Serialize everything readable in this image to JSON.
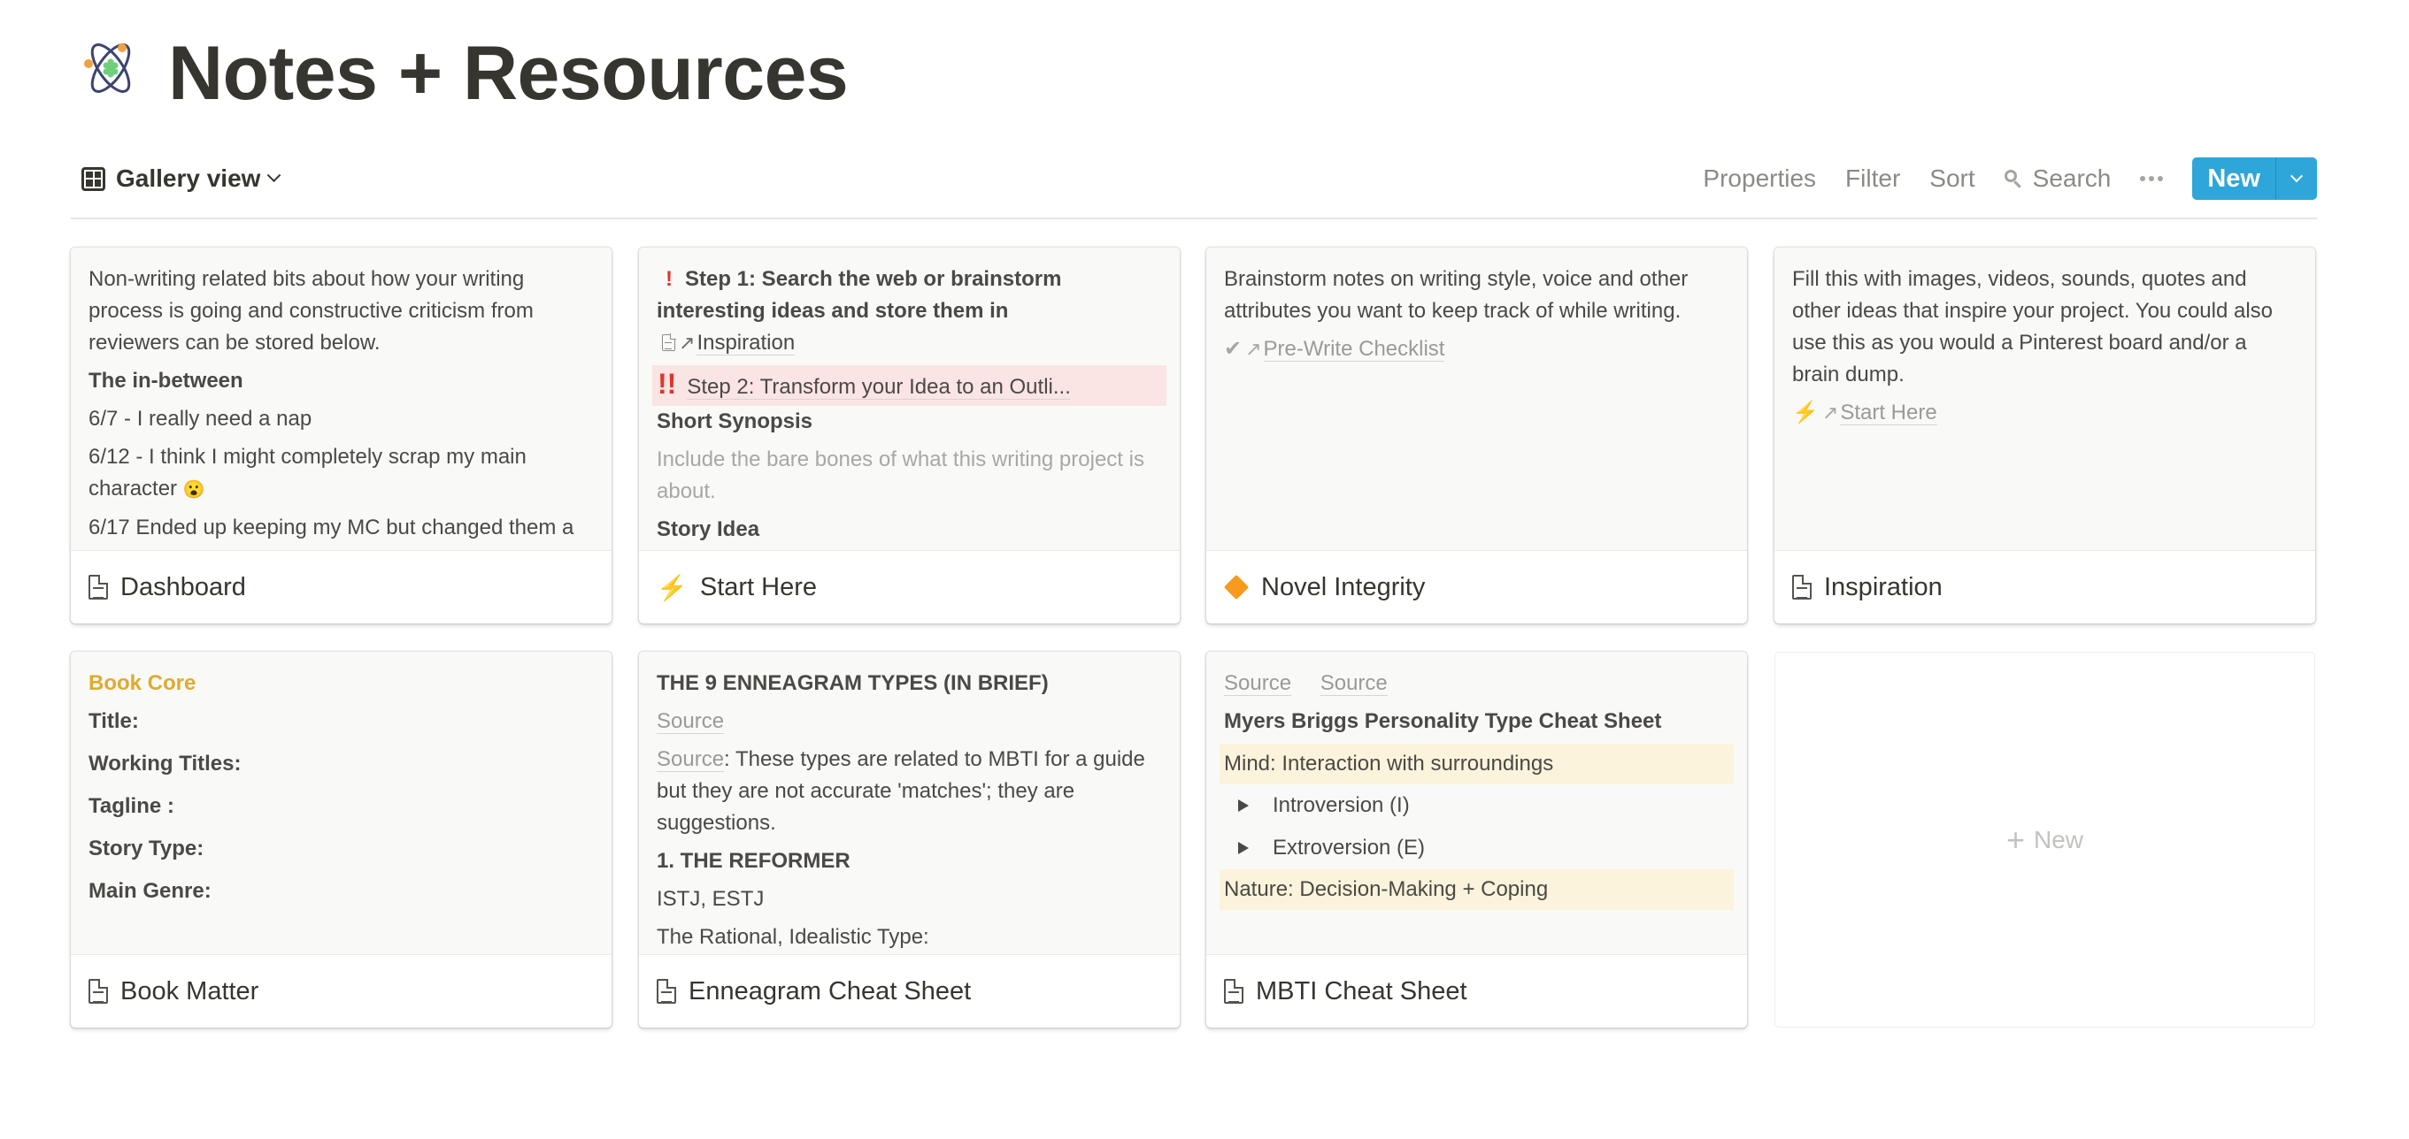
{
  "page": {
    "title": "Notes + Resources",
    "icon": "atom-icon"
  },
  "toolbar": {
    "view_label": "Gallery view",
    "view_icon": "gallery-grid-icon",
    "properties": "Properties",
    "filter": "Filter",
    "sort": "Sort",
    "search": "Search",
    "more": "more-options-icon",
    "new": "New"
  },
  "colors": {
    "accent_blue": "#2ea6d9",
    "title_text": "#37352f",
    "muted_text": "#8b8a86",
    "highlight_red": "#fbe4e4",
    "highlight_yellow": "#fbf3db",
    "gold_heading": "#dfab2f"
  },
  "cards": [
    {
      "title": "Dashboard",
      "icon": "page-icon",
      "preview": {
        "intro": "Non-writing related bits about how your writing process is going and constructive criticism from reviewers can be stored below.",
        "heading": "The in-between",
        "entries": [
          "6/7 - I really need a nap",
          "6/12 - I think I might completely scrap my main character",
          "6/17 Ended up keeping my MC but changed them a"
        ],
        "emoji": "😮"
      }
    },
    {
      "title": "Start Here",
      "icon": "lightning-icon",
      "preview": {
        "step1": "Step 1: Search the web or brainstorm interesting ideas and store them in",
        "step1_link": "Inspiration",
        "step2": "Step 2: Transform your Idea to an Outli...",
        "heading": "Short Synopsis",
        "placeholder": "Include the bare bones of what this writing project is about.",
        "clipped": "Story Idea"
      }
    },
    {
      "title": "Novel Integrity",
      "icon": "orange-diamond-icon",
      "preview": {
        "intro": "Brainstorm notes on writing style, voice and other attributes you want to keep track of while writing.",
        "link": "Pre-Write Checklist"
      }
    },
    {
      "title": "Inspiration",
      "icon": "page-icon",
      "preview": {
        "intro": "Fill this with images, videos, sounds, quotes and other ideas that inspire your project. You could also use this as you would a Pinterest board and/or a brain dump.",
        "link": "Start Here"
      }
    },
    {
      "title": "Book Matter",
      "icon": "page-icon",
      "preview": {
        "heading": "Book Core",
        "fields": [
          "Title:",
          "Working Titles:",
          "Tagline :",
          "Story Type:",
          "Main Genre:"
        ]
      }
    },
    {
      "title": "Enneagram Cheat Sheet",
      "icon": "page-icon",
      "preview": {
        "heading": "THE 9 ENNEAGRAM TYPES (IN BRIEF)",
        "source_link": "Source",
        "source_inline": "Source",
        "source_text": ": These types are related to MBTI for a guide but they are not accurate 'matches'; they are suggestions.",
        "type_heading": "1. THE REFORMER",
        "mbti": "ISTJ, ESTJ",
        "clipped": "The Rational, Idealistic Type:"
      }
    },
    {
      "title": "MBTI Cheat Sheet",
      "icon": "page-icon",
      "preview": {
        "sources": [
          "Source",
          "Source"
        ],
        "heading": "Myers Briggs Personality Type Cheat Sheet",
        "section1": "Mind: Interaction with surroundings",
        "toggles": [
          "Introversion (I)",
          "Extroversion (E)"
        ],
        "section2": "Nature: Decision-Making + Coping"
      }
    }
  ],
  "add_card": {
    "label": "New"
  }
}
